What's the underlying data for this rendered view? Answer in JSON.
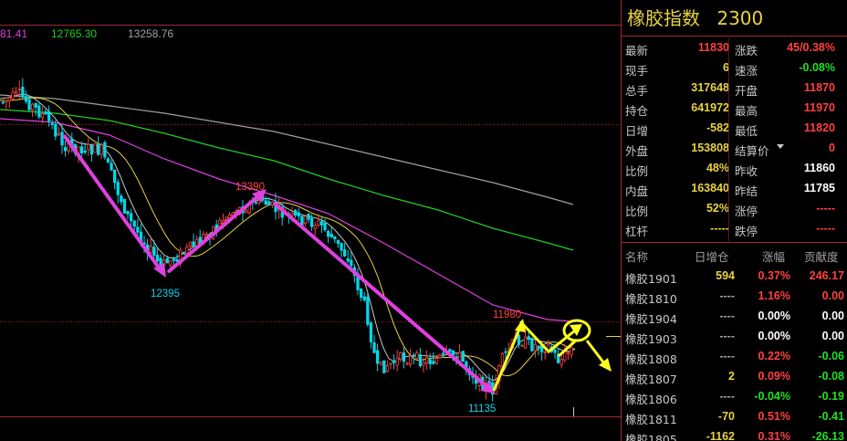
{
  "colors": {
    "up": "#ff4040",
    "down": "#00d8e8",
    "ma_white": "#c8c8c8",
    "ma_yellow": "#e8d240",
    "ma_magenta": "#e040e0",
    "ma_green": "#20d020",
    "ma_gray": "#a0a0a0",
    "arrow_magenta": "#e040e0",
    "arrow_yellow": "#ffff20",
    "frame_red": "#a0282a"
  },
  "chart": {
    "ma_labels": [
      {
        "text": "81.41",
        "color": "#e040e0"
      },
      {
        "text": "12765.30",
        "color": "#20d020"
      },
      {
        "text": "13258.76",
        "color": "#a0a0a0"
      }
    ],
    "annotations": {
      "high_1": "13390",
      "low_1": "12395",
      "high_2": "11980",
      "low_2": "11135"
    }
  },
  "panel": {
    "title": "橡胶指数",
    "code": "2300",
    "quote_rows": [
      {
        "l1": "最新",
        "v1": "11830",
        "c1": "red",
        "l2": "涨跌",
        "v2": "45/0.38%",
        "c2": "red"
      },
      {
        "l1": "现手",
        "v1": "6",
        "c1": "yellow",
        "l2": "速涨",
        "v2": "-0.08%",
        "c2": "green"
      },
      {
        "l1": "总手",
        "v1": "317648",
        "c1": "yellow",
        "l2": "开盘",
        "v2": "11870",
        "c2": "red"
      },
      {
        "l1": "持仓",
        "v1": "641972",
        "c1": "yellow",
        "l2": "最高",
        "v2": "11970",
        "c2": "red"
      },
      {
        "l1": "日增",
        "v1": "-582",
        "c1": "yellow",
        "l2": "最低",
        "v2": "11820",
        "c2": "red"
      },
      {
        "l1": "外盘",
        "v1": "153808",
        "c1": "yellow",
        "l2": "结算价",
        "v2": "0",
        "c2": "red"
      },
      {
        "l1": "比例",
        "v1": "48%",
        "c1": "yellow",
        "l2": "昨收",
        "v2": "11860",
        "c2": "white"
      },
      {
        "l1": "内盘",
        "v1": "163840",
        "c1": "yellow",
        "l2": "昨结",
        "v2": "11785",
        "c2": "white"
      },
      {
        "l1": "比例",
        "v1": "52%",
        "c1": "yellow",
        "l2": "涨停",
        "v2": "-----",
        "c2": "red"
      },
      {
        "l1": "杠杆",
        "v1": "-----",
        "c1": "yellow",
        "l2": "跌停",
        "v2": "-----",
        "c2": "red"
      }
    ],
    "list_headers": [
      "名称",
      "日增仓",
      "涨幅",
      "贡献度"
    ],
    "list_rows": [
      {
        "name": "橡胶1901",
        "inc": "594",
        "ic": "yellow",
        "chg": "0.37%",
        "cc": "red",
        "contrib": "246.17",
        "tc": "red"
      },
      {
        "name": "橡胶1810",
        "inc": "----",
        "ic": "gray",
        "chg": "1.16%",
        "cc": "red",
        "contrib": "0.00",
        "tc": "red"
      },
      {
        "name": "橡胶1904",
        "inc": "----",
        "ic": "gray",
        "chg": "0.00%",
        "cc": "white",
        "contrib": "0.00",
        "tc": "white"
      },
      {
        "name": "橡胶1903",
        "inc": "----",
        "ic": "gray",
        "chg": "0.00%",
        "cc": "white",
        "contrib": "0.00",
        "tc": "white"
      },
      {
        "name": "橡胶1808",
        "inc": "----",
        "ic": "gray",
        "chg": "0.22%",
        "cc": "red",
        "contrib": "-0.06",
        "tc": "green"
      },
      {
        "name": "橡胶1807",
        "inc": "2",
        "ic": "yellow",
        "chg": "0.09%",
        "cc": "red",
        "contrib": "-0.08",
        "tc": "green"
      },
      {
        "name": "橡胶1806",
        "inc": "----",
        "ic": "gray",
        "chg": "-0.04%",
        "cc": "green",
        "contrib": "-0.19",
        "tc": "green"
      },
      {
        "name": "橡胶1811",
        "inc": "-70",
        "ic": "yellow",
        "chg": "0.51%",
        "cc": "red",
        "contrib": "-0.41",
        "tc": "green"
      },
      {
        "name": "橡胶1805",
        "inc": "-1162",
        "ic": "yellow",
        "chg": "0.31%",
        "cc": "red",
        "contrib": "-26.13",
        "tc": "green"
      }
    ]
  }
}
